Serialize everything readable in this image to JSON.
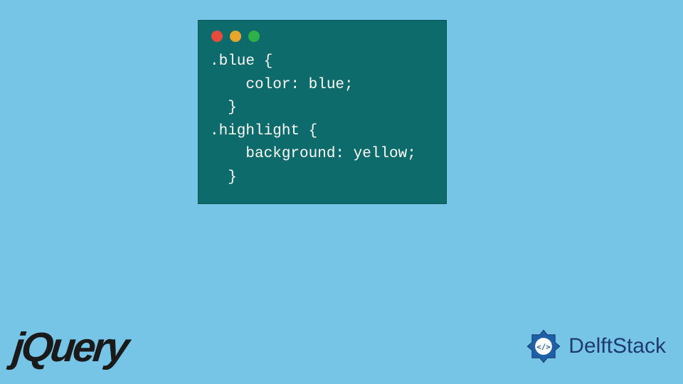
{
  "code": {
    "lines": [
      ".blue {",
      "    color: blue;",
      "  }",
      ".highlight {",
      "    background: yellow;",
      "  }"
    ]
  },
  "logos": {
    "jquery": "jQuery",
    "delftstack": "DelftStack"
  },
  "window": {
    "dot_colors": {
      "red": "#e64b3c",
      "yellow": "#e8a62d",
      "green": "#2fb14a"
    },
    "background": "#0d6b6b"
  },
  "page": {
    "background": "#76c5e7"
  }
}
